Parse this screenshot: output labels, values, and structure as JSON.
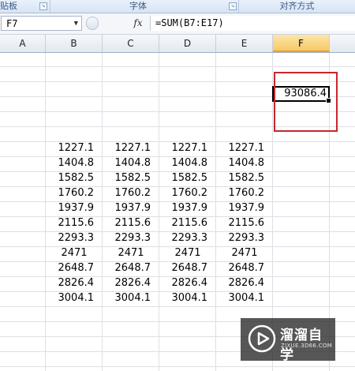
{
  "ribbon": {
    "groups": [
      {
        "label": "贴板"
      },
      {
        "label": "字体"
      },
      {
        "label": "对齐方式"
      }
    ]
  },
  "formula_bar": {
    "name_box": "F7",
    "fx_label": "fx",
    "formula": "=SUM(B7:E17)"
  },
  "columns": [
    "A",
    "B",
    "C",
    "D",
    "E",
    "F"
  ],
  "active_column": "F",
  "data_rows": [
    [
      "1227.1",
      "1227.1",
      "1227.1",
      "1227.1"
    ],
    [
      "1404.8",
      "1404.8",
      "1404.8",
      "1404.8"
    ],
    [
      "1582.5",
      "1582.5",
      "1582.5",
      "1582.5"
    ],
    [
      "1760.2",
      "1760.2",
      "1760.2",
      "1760.2"
    ],
    [
      "1937.9",
      "1937.9",
      "1937.9",
      "1937.9"
    ],
    [
      "2115.6",
      "2115.6",
      "2115.6",
      "2115.6"
    ],
    [
      "2293.3",
      "2293.3",
      "2293.3",
      "2293.3"
    ],
    [
      "2471",
      "2471",
      "2471",
      "2471"
    ],
    [
      "2648.7",
      "2648.7",
      "2648.7",
      "2648.7"
    ],
    [
      "2826.4",
      "2826.4",
      "2826.4",
      "2826.4"
    ],
    [
      "3004.1",
      "3004.1",
      "3004.1",
      "3004.1"
    ]
  ],
  "active_cell": {
    "ref": "F7",
    "value": "93086.4"
  },
  "annotation_color": "#c8262c",
  "watermark": {
    "title": "溜溜自学",
    "url": "ZIXUE.3D66.COM"
  }
}
